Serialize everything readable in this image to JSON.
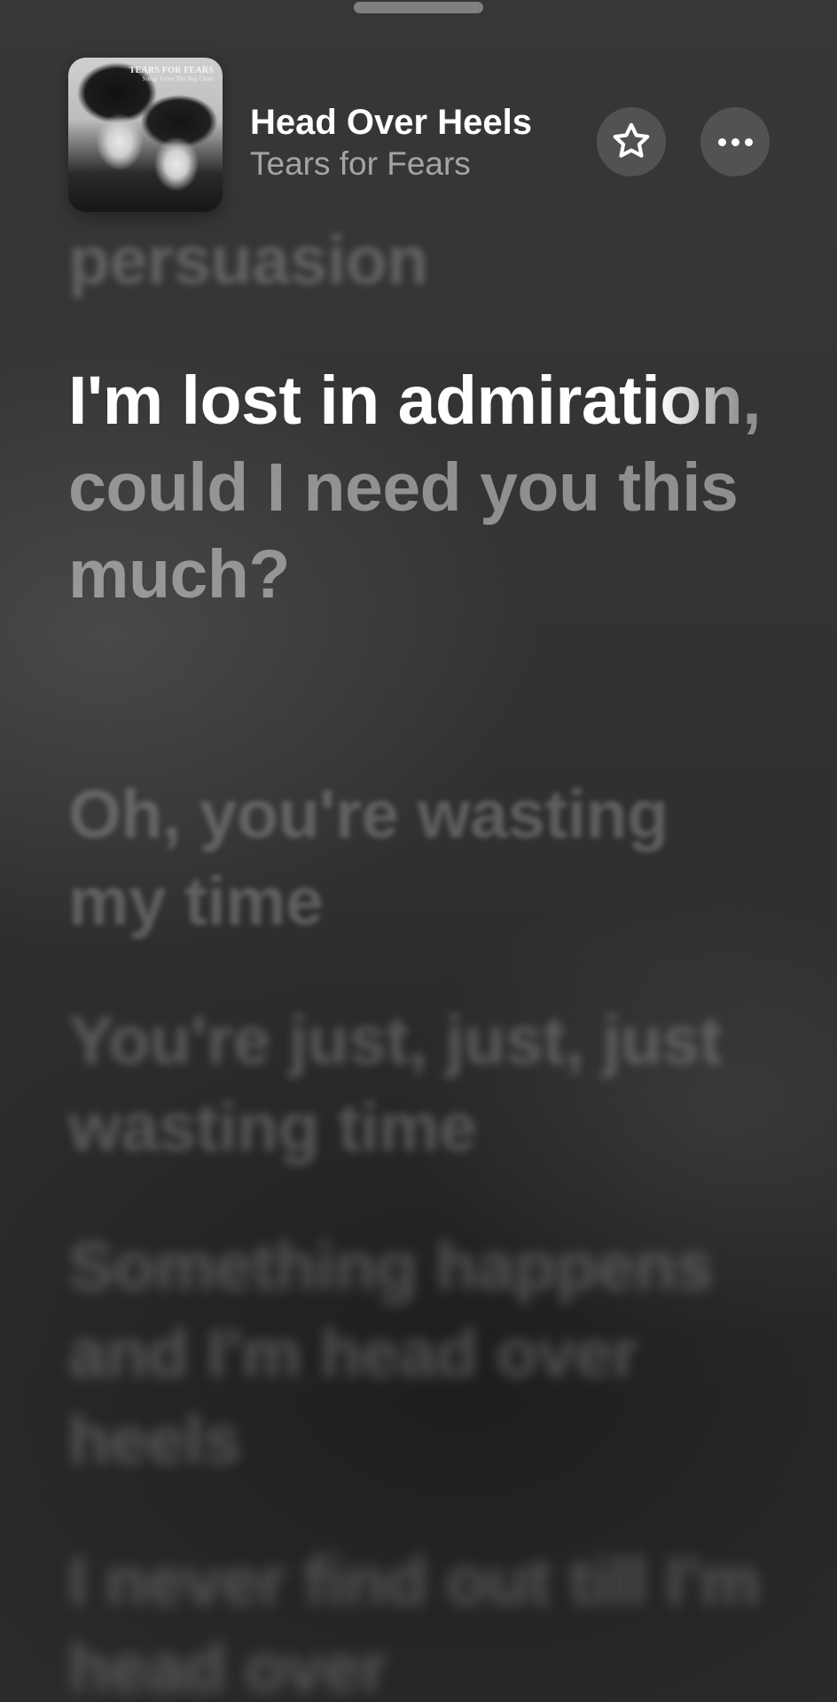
{
  "header": {
    "album": {
      "caption_band": "TEARS FOR FEARS",
      "caption_album": "Songs From The Big Chair"
    },
    "track_title": "Head Over Heels",
    "artist": "Tears for Fears",
    "favorite_icon": "star-outline-icon",
    "more_icon": "ellipsis-icon"
  },
  "lyrics": {
    "previous_line_fragment": "persuasion",
    "current": {
      "sung": "I'm lost in admirati",
      "transition": "on",
      "unsung": ", could I need you this much?"
    },
    "upcoming": [
      "Oh, you're wasting my time",
      "You're just, just, just wasting time",
      "Something happens and I'm head over heels",
      "I never find out till I'm head over"
    ]
  },
  "colors": {
    "background": "#2f2f2f",
    "active_text": "#ffffff",
    "secondary_text": "rgba(255,255,255,0.55)",
    "dim_text": "rgba(255,255,255,0.22)"
  }
}
